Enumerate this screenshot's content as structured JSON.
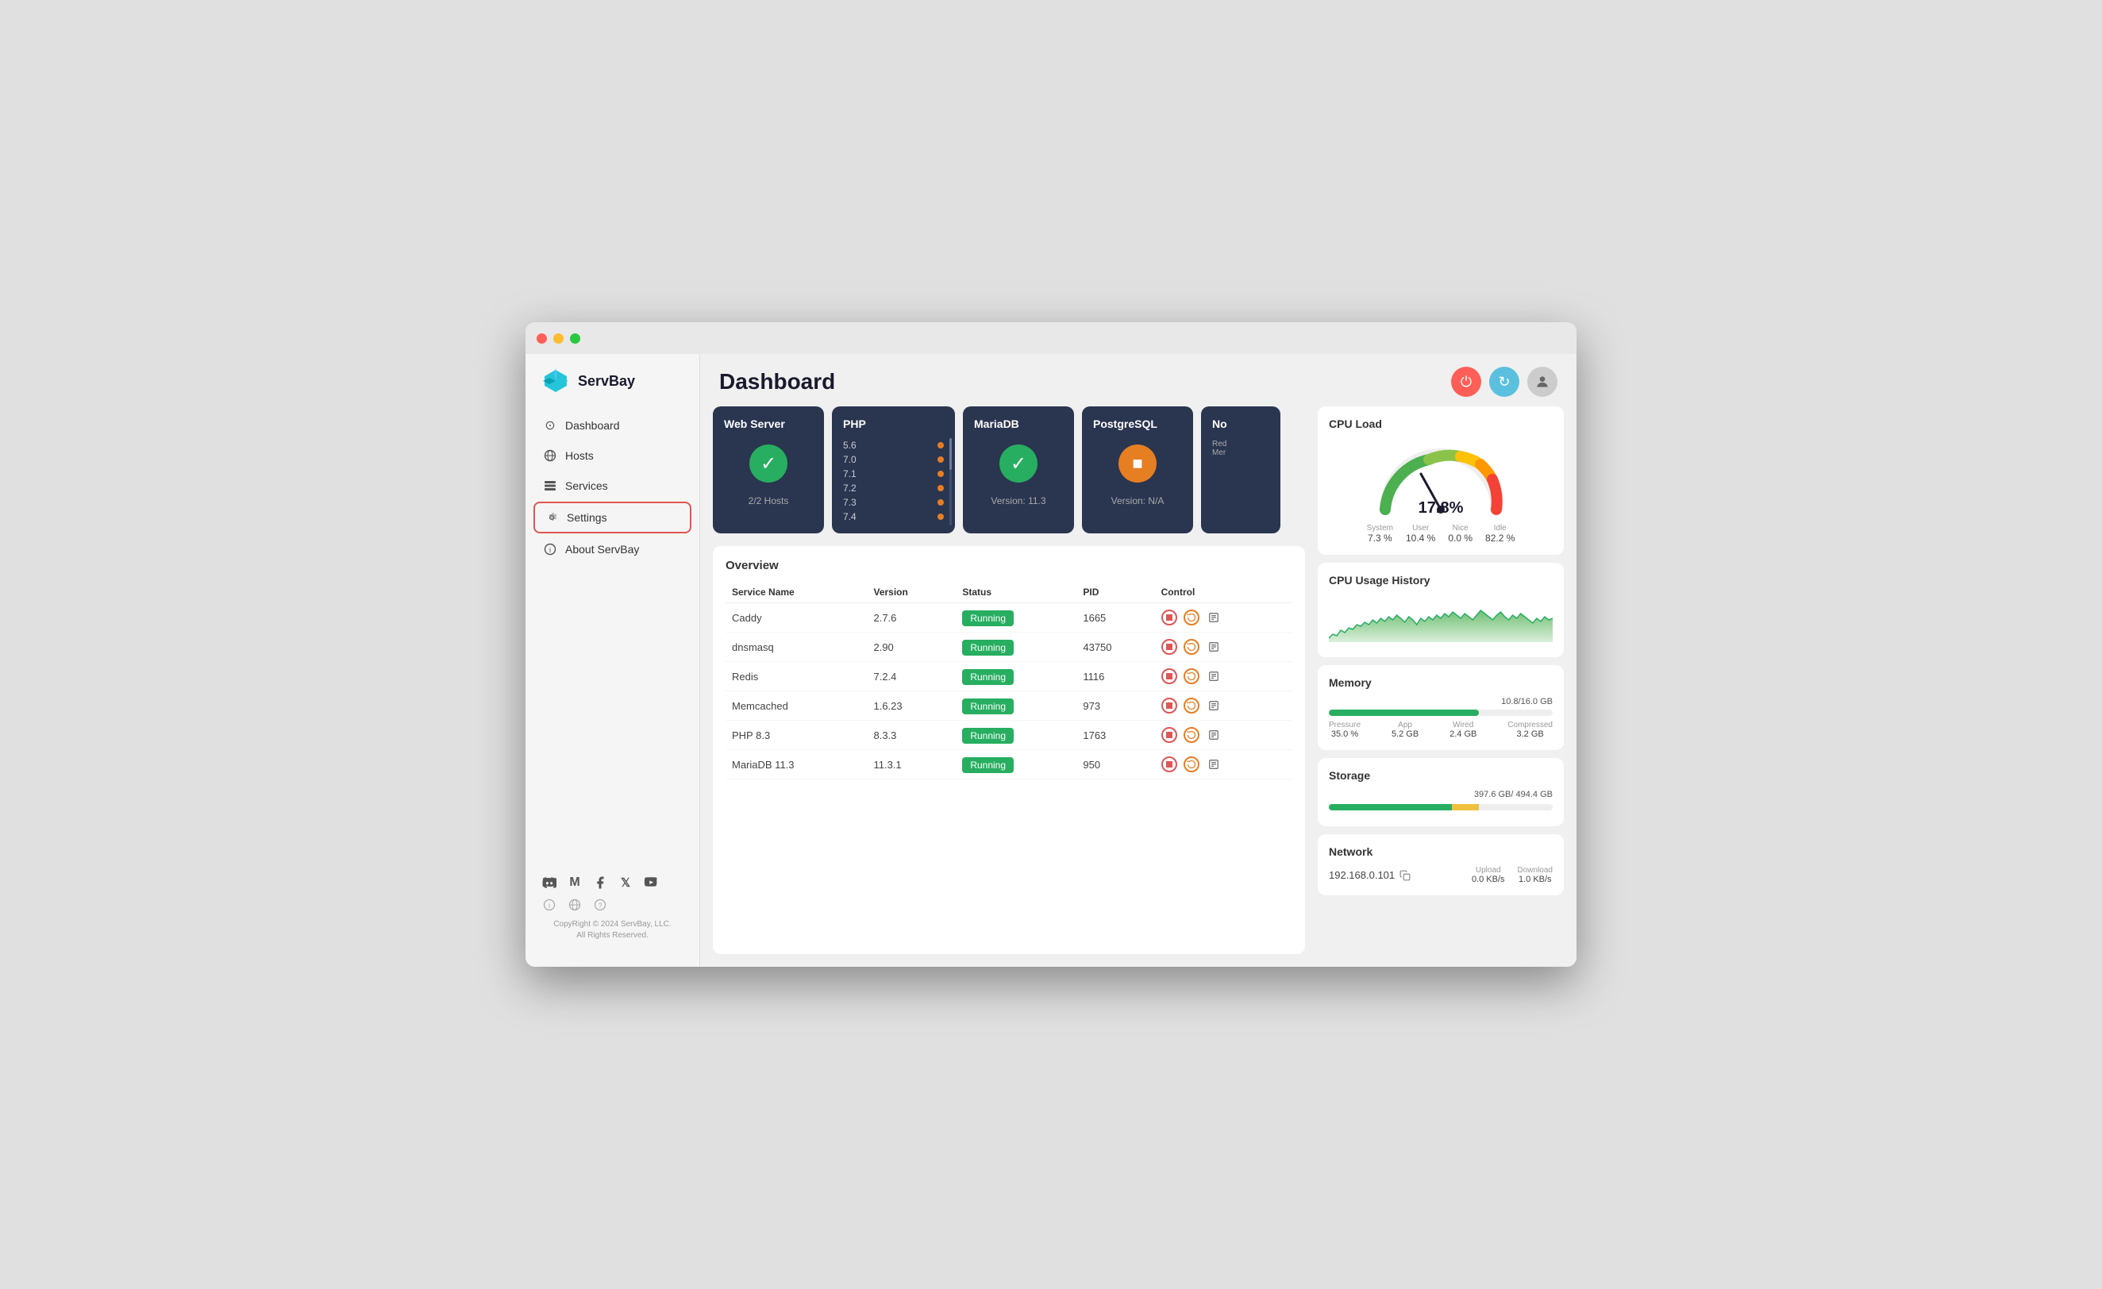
{
  "window": {
    "title": "ServBay Dashboard"
  },
  "sidebar": {
    "logo_text": "ServBay",
    "nav_items": [
      {
        "id": "dashboard",
        "label": "Dashboard",
        "icon": "⊙"
      },
      {
        "id": "hosts",
        "label": "Hosts",
        "icon": "🌐"
      },
      {
        "id": "services",
        "label": "Services",
        "icon": "≡"
      },
      {
        "id": "settings",
        "label": "Settings",
        "icon": "⚙",
        "active": true
      },
      {
        "id": "about",
        "label": "About ServBay",
        "icon": "ℹ"
      }
    ],
    "copyright": "CopyRight © 2024 ServBay, LLC.\nAll Rights Reserved."
  },
  "header": {
    "title": "Dashboard",
    "actions": {
      "power_label": "⏻",
      "refresh_label": "↻",
      "user_label": "👤"
    }
  },
  "cards": [
    {
      "id": "webserver",
      "title": "Web Server",
      "status": "check",
      "subtitle": "2/2 Hosts"
    },
    {
      "id": "php",
      "title": "PHP",
      "status": "list",
      "versions": [
        "5.6",
        "7.0",
        "7.1",
        "7.2",
        "7.3",
        "7.4"
      ]
    },
    {
      "id": "mariadb",
      "title": "MariaDB",
      "status": "check",
      "subtitle": "Version: 11.3"
    },
    {
      "id": "postgresql",
      "title": "PostgreSQL",
      "status": "stop",
      "subtitle": "Version: N/A"
    },
    {
      "id": "nol",
      "title": "No",
      "subtitle": "Red\nMer",
      "status": "partial"
    }
  ],
  "overview": {
    "title": "Overview",
    "columns": [
      "Service Name",
      "Version",
      "Status",
      "PID",
      "Control"
    ],
    "rows": [
      {
        "name": "Caddy",
        "version": "2.7.6",
        "status": "Running",
        "pid": "1665"
      },
      {
        "name": "dnsmasq",
        "version": "2.90",
        "status": "Running",
        "pid": "43750"
      },
      {
        "name": "Redis",
        "version": "7.2.4",
        "status": "Running",
        "pid": "1116"
      },
      {
        "name": "Memcached",
        "version": "1.6.23",
        "status": "Running",
        "pid": "973"
      },
      {
        "name": "PHP 8.3",
        "version": "8.3.3",
        "status": "Running",
        "pid": "1763"
      },
      {
        "name": "MariaDB 11.3",
        "version": "11.3.1",
        "status": "Running",
        "pid": "950"
      }
    ]
  },
  "cpu_load": {
    "section_title": "CPU Load",
    "value": "17.8%",
    "stats": [
      {
        "label": "System",
        "value": "7.3 %"
      },
      {
        "label": "User",
        "value": "10.4 %"
      },
      {
        "label": "Nice",
        "value": "0.0 %"
      },
      {
        "label": "Idle",
        "value": "82.2 %"
      }
    ]
  },
  "cpu_history": {
    "section_title": "CPU Usage History"
  },
  "memory": {
    "section_title": "Memory",
    "value": "10.8/16.0 GB",
    "fill_percent": 67,
    "stats": [
      {
        "label": "Pressure",
        "value": "35.0 %"
      },
      {
        "label": "App",
        "value": "5.2 GB"
      },
      {
        "label": "Wired",
        "value": "2.4 GB"
      },
      {
        "label": "Compressed",
        "value": "3.2 GB"
      }
    ]
  },
  "storage": {
    "section_title": "Storage",
    "value": "397.6 GB/ 494.4 GB"
  },
  "network": {
    "section_title": "Network",
    "ip": "192.168.0.101",
    "upload_label": "Upload",
    "upload_value": "0.0 KB/s",
    "download_label": "Download",
    "download_value": "1.0 KB/s"
  }
}
